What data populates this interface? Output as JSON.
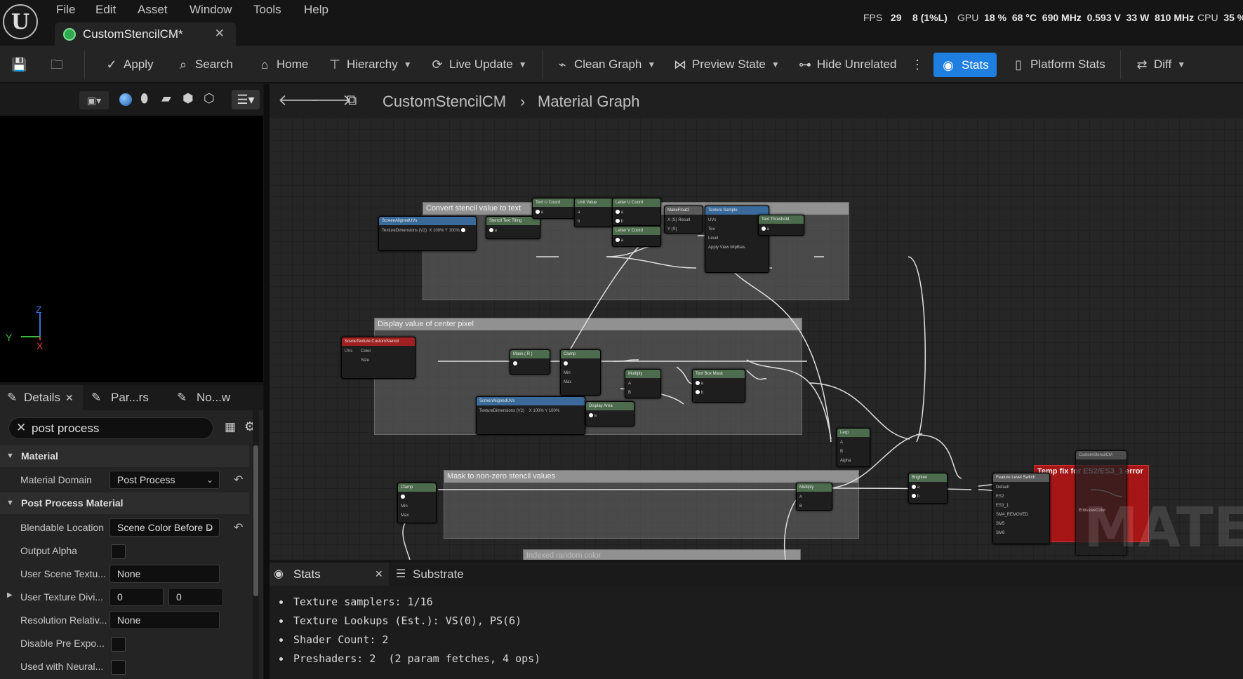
{
  "app": {
    "logo_letter": "U",
    "menu": [
      "File",
      "Edit",
      "Asset",
      "Window",
      "Tools",
      "Help"
    ],
    "document_tab": "CustomStencilCM*",
    "perf": {
      "fps_label": "FPS",
      "fps_value": "29",
      "frame_ms": "8",
      "frame_pct": "(1%L)",
      "gpu_label": "GPU",
      "gpu_pct": "18 %",
      "gpu_temp": "68 °C",
      "gpu_clock": "690 MHz",
      "gpu_volt": "0.593 V",
      "gpu_watts": "33 W",
      "gpu_mem": "810 MHz",
      "cpu_label": "CPU",
      "cpu_pct": "35 %"
    }
  },
  "toolbar": {
    "apply": "Apply",
    "search": "Search",
    "home": "Home",
    "hierarchy": "Hierarchy",
    "live_update": "Live Update",
    "clean_graph": "Clean Graph",
    "preview_state": "Preview State",
    "hide_unrelated": "Hide Unrelated",
    "stats": "Stats",
    "platform_stats": "Platform Stats",
    "diff": "Diff"
  },
  "viewport": {
    "axis_z": "Z",
    "axis_y": "Y",
    "axis_x": "X"
  },
  "details": {
    "tabs": [
      "Details",
      "Par...rs",
      "No...w"
    ],
    "search_value": "post process",
    "categories": {
      "material": "Material",
      "post_process": "Post Process Material"
    },
    "material_domain": {
      "label": "Material Domain",
      "value": "Post Process"
    },
    "blendable_location": {
      "label": "Blendable Location",
      "value": "Scene Color Before D"
    },
    "output_alpha": {
      "label": "Output Alpha"
    },
    "user_scene_texture": {
      "label": "User Scene Textu...",
      "value": "None"
    },
    "user_texture_divisor": {
      "label": "User Texture Divi...",
      "x": "0",
      "y": "0"
    },
    "resolution_relative": {
      "label": "Resolution Relativ...",
      "value": "None"
    },
    "disable_pre_exposure": {
      "label": "Disable Pre Expo..."
    },
    "used_with_neural": {
      "label": "Used with Neural..."
    }
  },
  "graph": {
    "breadcrumb_asset": "CustomStencilCM",
    "breadcrumb_graph": "Material Graph",
    "watermark": "MATERI",
    "comments": {
      "convert": "Convert stencil value to text",
      "display": "Display value of center pixel",
      "mask": "Mask to non-zero stencil values",
      "indexed": "Indexed random color",
      "temp_fix": "Temp fix for ES2/ES3_1 error"
    },
    "nodes": {
      "screen_uvs_1": "ScreenAlignedUVs",
      "stencil_tiling": "Stencil Text Tiling",
      "text_u": "Text U Coord",
      "unit_value": "Unit Value",
      "letter_u": "Letter U Coord",
      "letter_v": "Letter V Coord",
      "makefloat2": "MakeFloat2",
      "texture_sample": "Texture Sample",
      "text_threshold": "Text Threshold",
      "scene_texture": "SceneTexture:CustomStencil",
      "mask_r": "Mask ( R )",
      "clamp_1": "Clamp",
      "multiply_1": "Multiply",
      "text_box_mask": "Text Box Mask",
      "screen_uvs_2": "ScreenAlignedUVs",
      "display_area": "Display Area",
      "lerp": "Lerp",
      "clamp_2": "Clamp",
      "multiply_2": "Multiply",
      "brighten": "Brighten",
      "feature_level_switch": "Feature Level Switch",
      "result": "CustomStencilCM"
    }
  },
  "stats_panel": {
    "tab_stats": "Stats",
    "tab_substrate": "Substrate",
    "lines": [
      "Texture samplers: 1/16",
      "Texture Lookups (Est.): VS(0), PS(6)",
      "Shader Count: 2",
      "Preshaders: 2  (2 param fetches, 4 ops)"
    ]
  }
}
